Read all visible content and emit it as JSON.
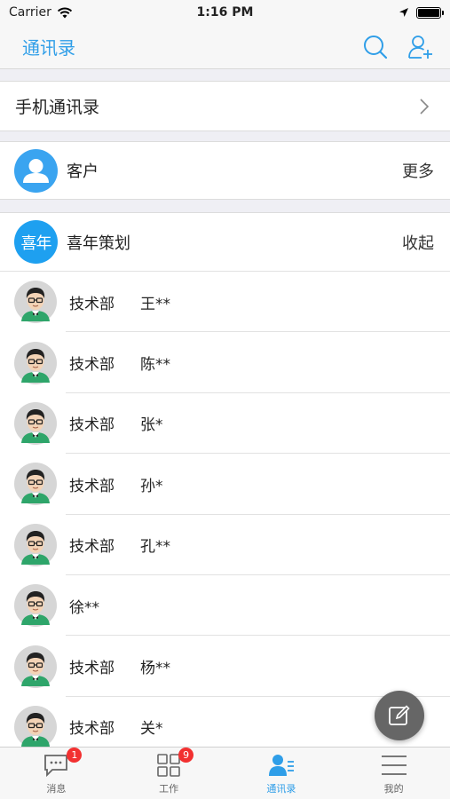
{
  "status_bar": {
    "carrier": "Carrier",
    "time": "1:16 PM",
    "battery_level": 1.0
  },
  "nav": {
    "title": "通讯录"
  },
  "phone_contacts": {
    "label": "手机通讯录"
  },
  "customer": {
    "label": "客户",
    "action": "更多"
  },
  "group": {
    "badge": "喜年",
    "name": "喜年策划",
    "action": "收起",
    "members": [
      {
        "dept": "技术部",
        "name": "王**"
      },
      {
        "dept": "技术部",
        "name": "陈**"
      },
      {
        "dept": "技术部",
        "name": "张*"
      },
      {
        "dept": "技术部",
        "name": "孙*"
      },
      {
        "dept": "技术部",
        "name": "孔**"
      },
      {
        "dept": "",
        "name": "徐**"
      },
      {
        "dept": "技术部",
        "name": "杨**"
      },
      {
        "dept": "技术部",
        "name": "关*"
      }
    ]
  },
  "tabs": [
    {
      "label": "消息",
      "badge": "1",
      "icon": "message-icon"
    },
    {
      "label": "工作",
      "badge": "9",
      "icon": "grid-icon"
    },
    {
      "label": "通讯录",
      "badge": "",
      "icon": "contacts-icon",
      "active": true
    },
    {
      "label": "我的",
      "badge": "",
      "icon": "menu-icon"
    }
  ],
  "colors": {
    "accent": "#2f9ee8",
    "badge": "#f23030",
    "group_badge": "#1ea0f0"
  }
}
